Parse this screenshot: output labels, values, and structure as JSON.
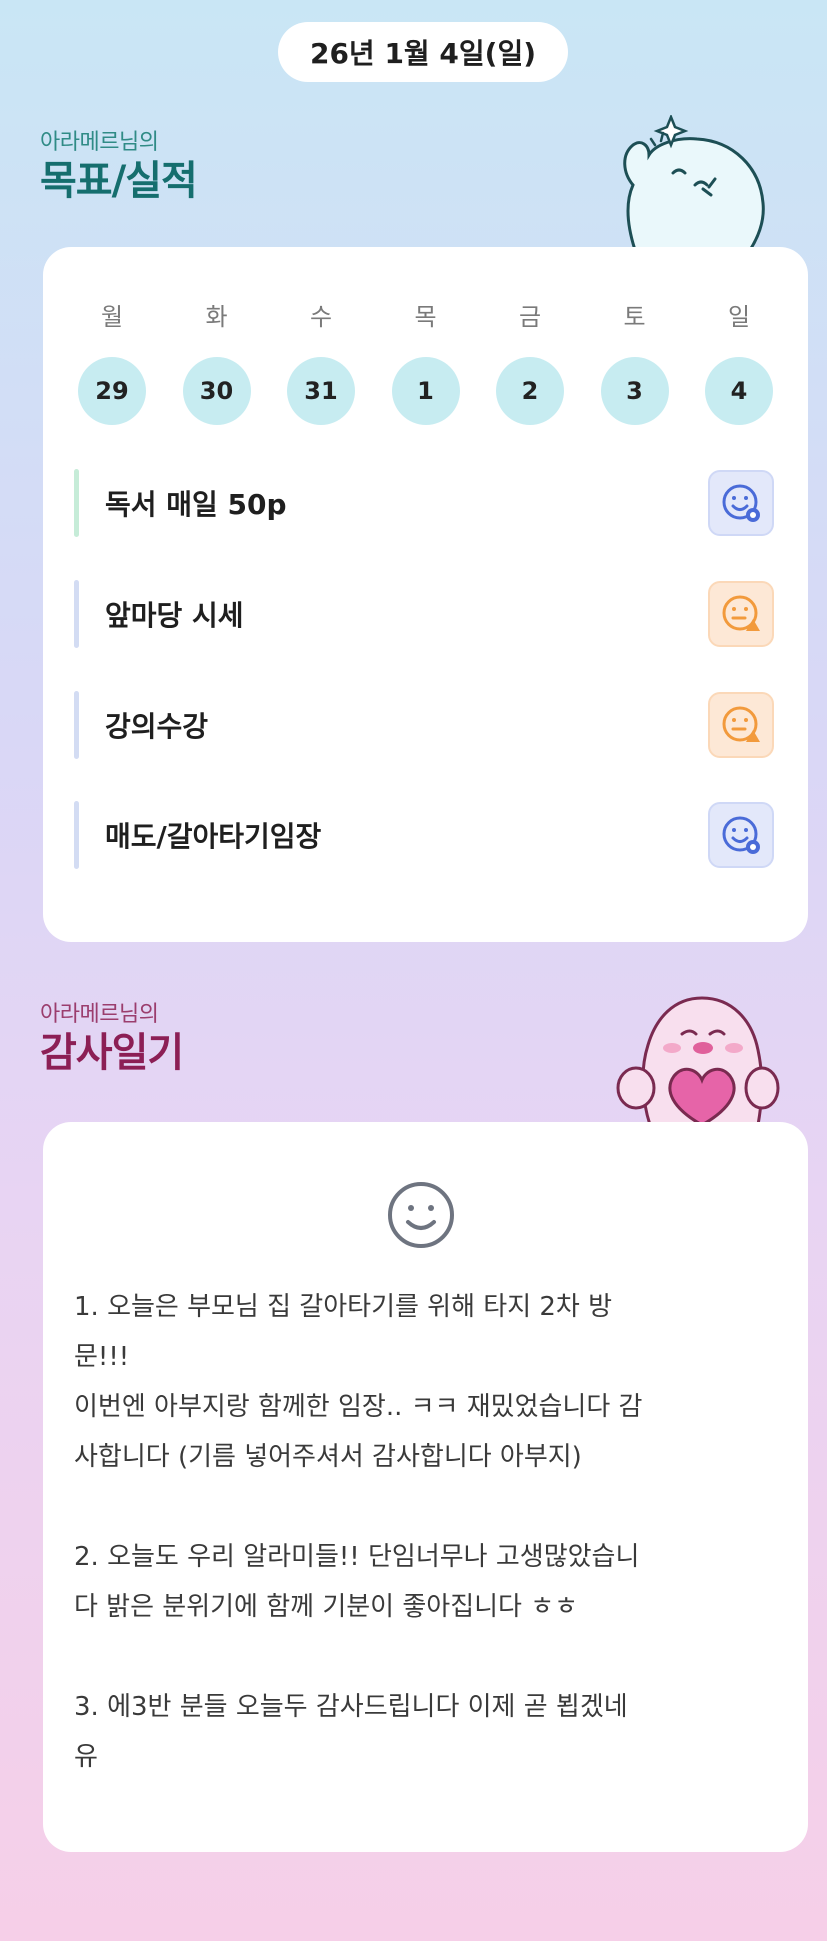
{
  "header": {
    "date": "26년 1월 4일(일)"
  },
  "goals_section": {
    "subtitle": "아라메르님의",
    "title": "목표/실적",
    "week": {
      "labels": [
        "월",
        "화",
        "수",
        "목",
        "금",
        "토",
        "일"
      ],
      "days": [
        "29",
        "30",
        "31",
        "1",
        "2",
        "3",
        "4"
      ]
    },
    "goals": [
      {
        "label": "독서 매일 50p",
        "status": "blue",
        "icon": "smile-status-icon"
      },
      {
        "label": "앞마당 시세",
        "status": "orange",
        "icon": "meh-warning-icon"
      },
      {
        "label": "강의수강",
        "status": "orange",
        "icon": "meh-warning-icon"
      },
      {
        "label": "매도/갈아타기임장",
        "status": "blue",
        "icon": "smile-status-icon"
      }
    ],
    "colors": {
      "blue": "#4a6bd8",
      "orange": "#f29a3c"
    }
  },
  "thanks_section": {
    "subtitle": "아라메르님의",
    "title": "감사일기",
    "text": "1. 오늘은 부모님 집 갈아타기를 위해 타지 2차 방\n문!!!\n이번엔 아부지랑 함께한 임장.. ㅋㅋ 재밌었습니다 감\n사합니다 (기름 넣어주셔서 감사합니다 아부지)\n\n2. 오늘도 우리 알라미들!! 단임너무나 고생많았습니\n다 밝은 분위기에 함께 기분이 좋아집니다 ㅎㅎ\n\n3. 에3반 분들 오늘두 감사드립니다 이제 곧 뵙겠네\n유"
  }
}
